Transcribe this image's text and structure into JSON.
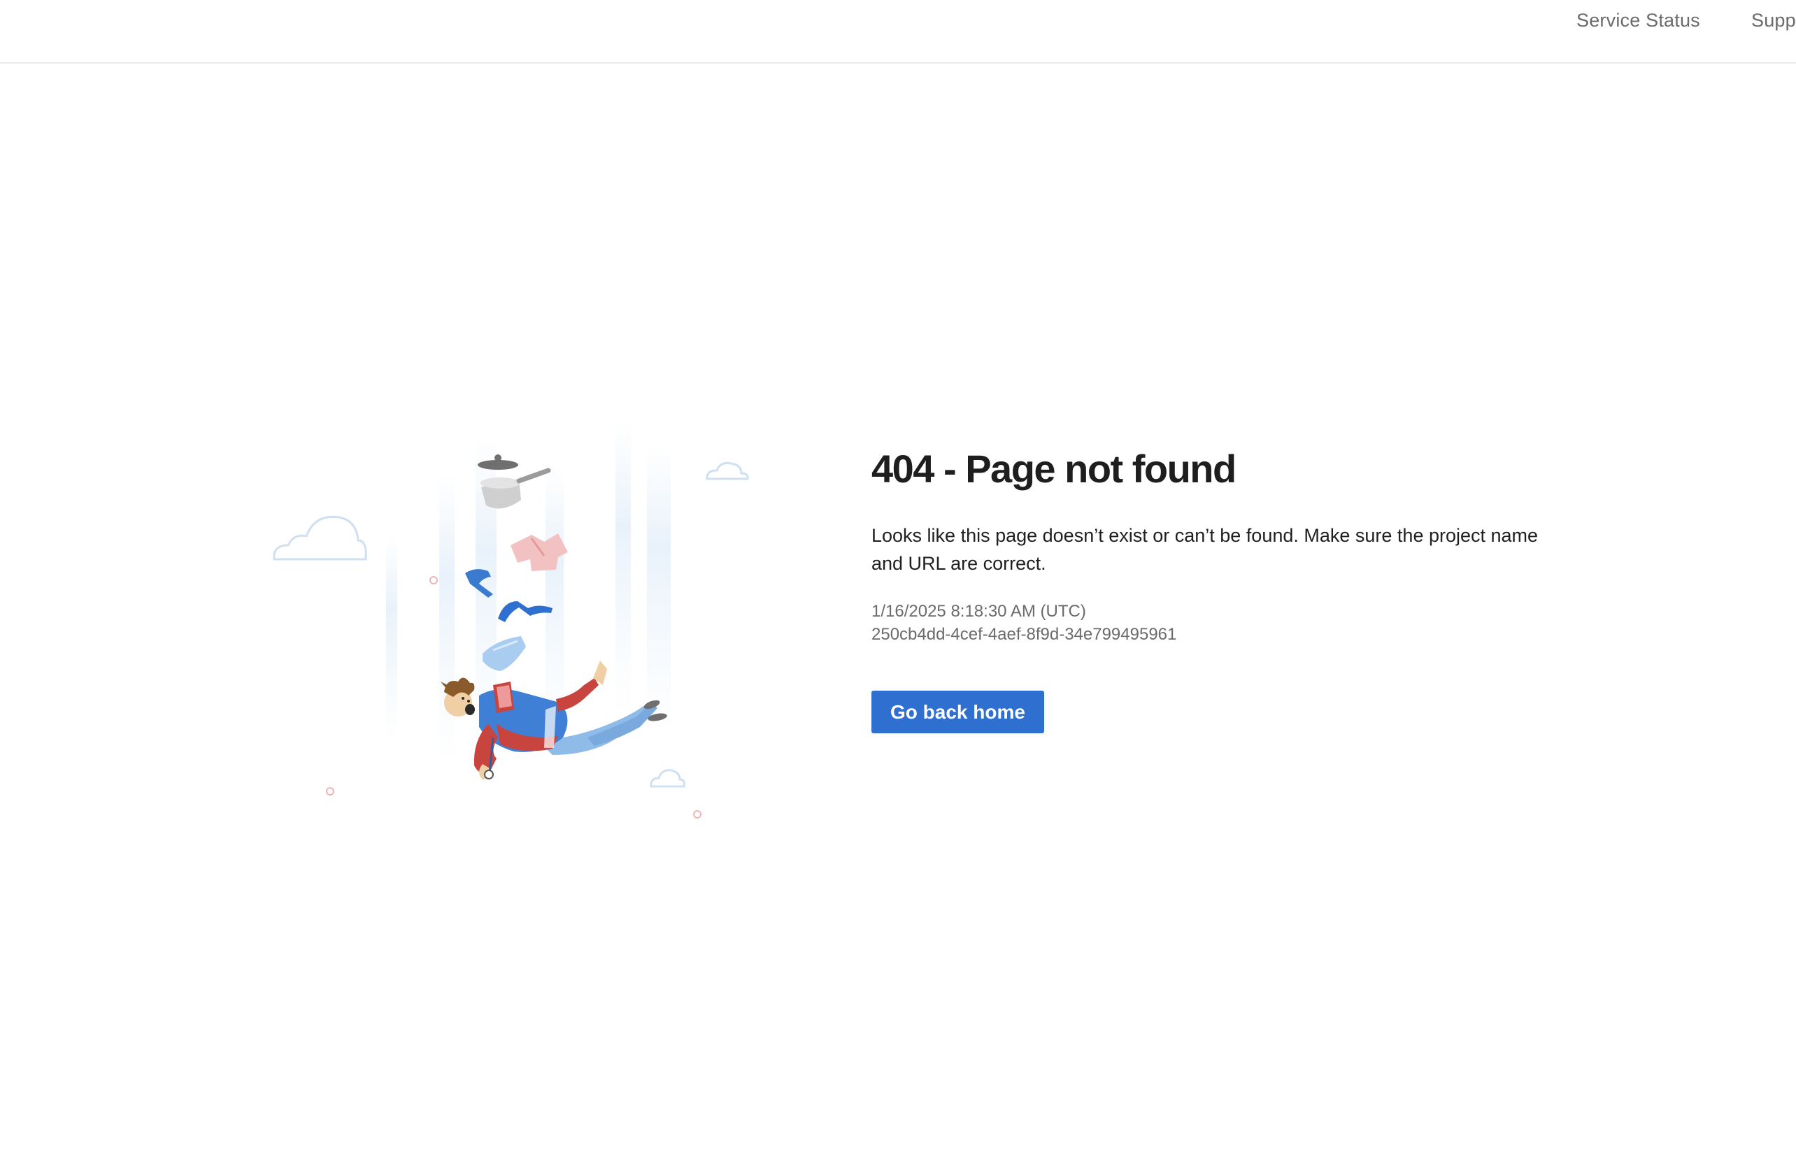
{
  "header": {
    "nav": [
      {
        "label": "Service Status"
      },
      {
        "label": "Supp"
      }
    ]
  },
  "error": {
    "title": "404 - Page not found",
    "description": "Looks like this page doesn’t exist or can’t be found. Make sure the project name and URL are correct.",
    "timestamp": "1/16/2025 8:18:30 AM (UTC)",
    "request_id": "250cb4dd-4cef-4aef-8f9d-34e799495961",
    "home_button_label": "Go back home"
  },
  "illustration": {
    "icon": "falling-person-illustration",
    "colors": {
      "accent": "#2f6fd0",
      "shirt": "#3f80d6",
      "scarf": "#c8443f",
      "pants": "#8fbbe8",
      "cloud": "#cfe0f2"
    }
  }
}
